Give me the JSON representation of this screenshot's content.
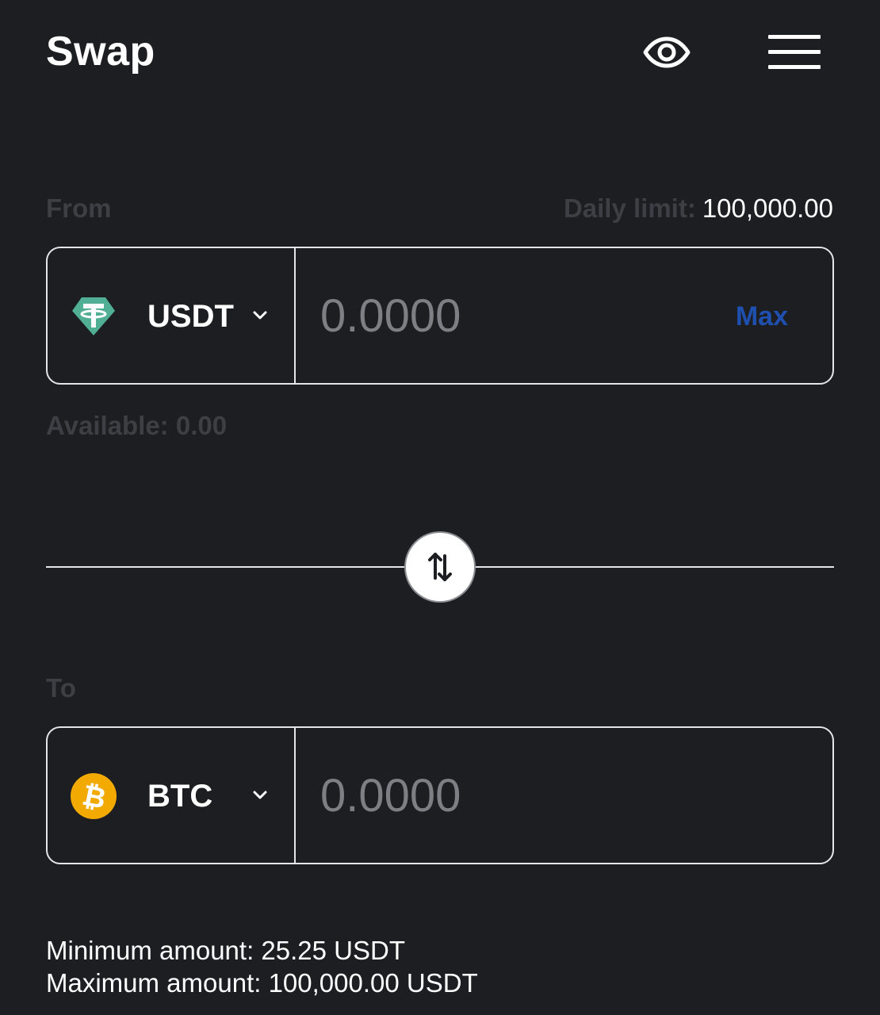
{
  "header": {
    "title": "Swap",
    "icons": [
      "eye-icon",
      "hamburger-menu-icon"
    ]
  },
  "from": {
    "label": "From",
    "daily_limit_label": "Daily limit:",
    "daily_limit_value": "100,000.00",
    "token": {
      "symbol": "USDT",
      "icon": "tether-icon",
      "color": "#50af95"
    },
    "amount_placeholder": "0.0000",
    "max_label": "Max",
    "available_text": "Available: 0.00"
  },
  "to": {
    "label": "To",
    "token": {
      "symbol": "BTC",
      "icon": "bitcoin-icon",
      "color": "#f2a900"
    },
    "amount_placeholder": "0.0000"
  },
  "limits": {
    "minimum": "Minimum amount: 25.25 USDT",
    "maximum": "Maximum amount: 100,000.00 USDT"
  },
  "colors": {
    "background": "#1d1e22",
    "muted_label": "#3d3f45",
    "border": "#e4e5e8",
    "accent_max": "#1f4faf",
    "placeholder": "#7d7f85"
  }
}
